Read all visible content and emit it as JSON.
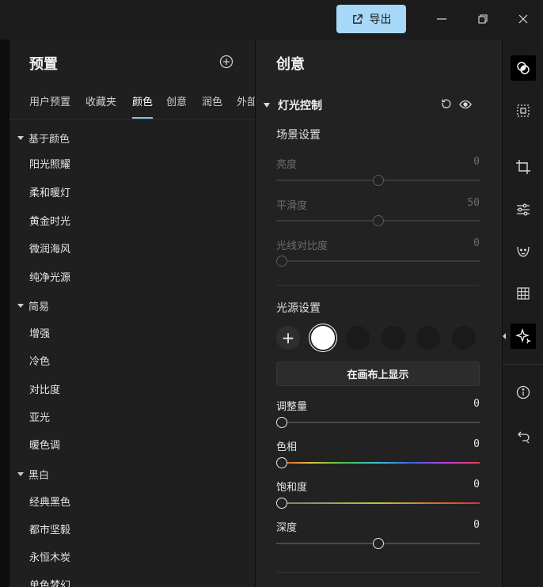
{
  "titlebar": {
    "export_label": "导出"
  },
  "presets": {
    "title": "预置",
    "tabs": [
      {
        "label": "用户预置"
      },
      {
        "label": "收藏夹"
      },
      {
        "label": "颜色"
      },
      {
        "label": "创意"
      },
      {
        "label": "润色"
      },
      {
        "label": "外部"
      }
    ],
    "active_tab": "颜色",
    "groups": [
      {
        "name": "基于颜色",
        "items": [
          "阳光照耀",
          "柔和暖灯",
          "黄金时光",
          "微润海风",
          "纯净光源"
        ]
      },
      {
        "name": "简易",
        "items": [
          "增强",
          "冷色",
          "对比度",
          "亚光",
          "暖色调"
        ]
      },
      {
        "name": "黑白",
        "items": [
          "经典黑色",
          "都市坚毅",
          "永恒木炭",
          "单色梦幻"
        ]
      }
    ]
  },
  "creative": {
    "title": "创意",
    "section": "灯光控制",
    "scene": {
      "title": "场景设置",
      "sliders": [
        {
          "label": "亮度",
          "value": "0",
          "level": 0.5
        },
        {
          "label": "平滑度",
          "value": "50",
          "level": 0.5
        },
        {
          "label": "光线对比度",
          "value": "0",
          "level": 0.0
        }
      ]
    },
    "light": {
      "title": "光源设置",
      "show_on_canvas": "在画布上显示",
      "sliders": [
        {
          "label": "调整量",
          "value": "0",
          "level": 0.0,
          "kind": "plain"
        },
        {
          "label": "色相",
          "value": "0",
          "level": 0.0,
          "kind": "hue"
        },
        {
          "label": "饱和度",
          "value": "0",
          "level": 0.0,
          "kind": "saturation"
        },
        {
          "label": "深度",
          "value": "0",
          "level": 0.5,
          "kind": "plain"
        }
      ]
    }
  },
  "toolbar": {
    "tools": [
      "presets-icon",
      "mask-icon",
      "crop-icon",
      "adjust-sliders-icon",
      "face-icon",
      "grid-icon",
      "creative-sparkle-icon",
      "info-icon",
      "undo-icon"
    ],
    "active": "creative-sparkle-icon"
  },
  "colors": {
    "accent": "#7ec4ef",
    "export_button": "#a8d8f8",
    "panel": "#222222"
  }
}
